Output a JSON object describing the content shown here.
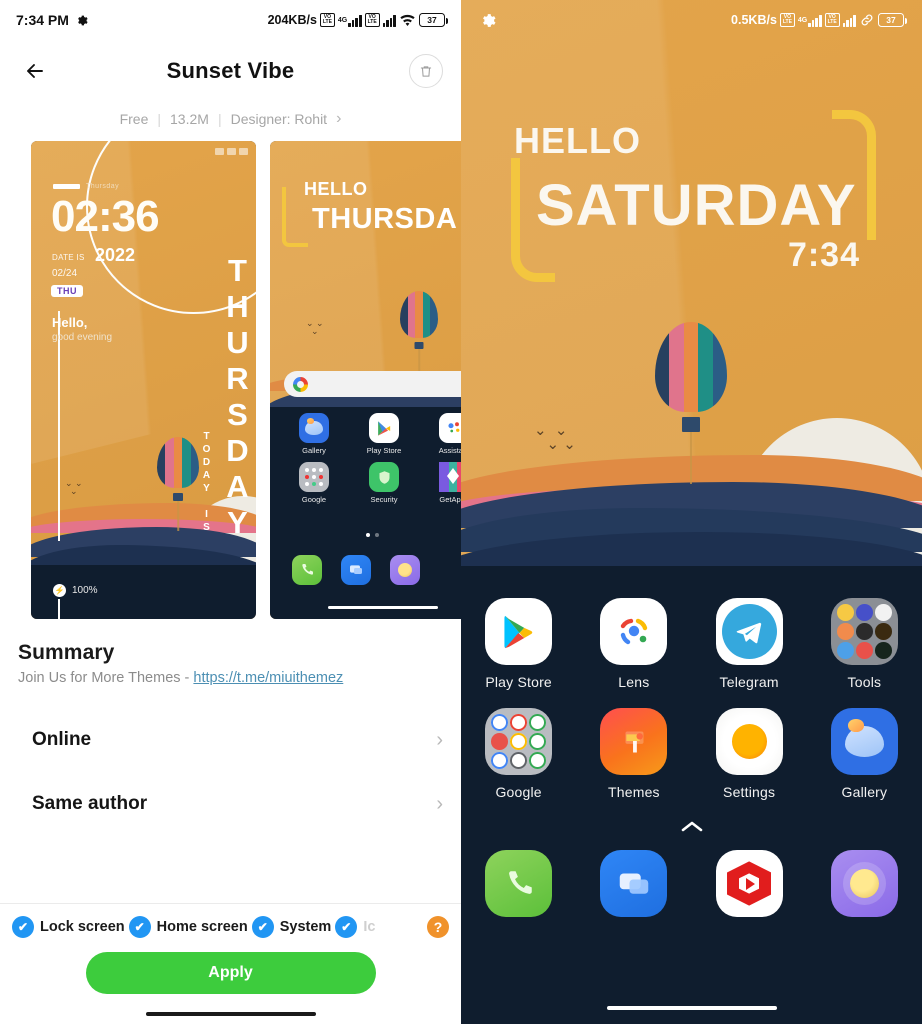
{
  "left": {
    "status_bar": {
      "time": "7:34 PM",
      "gear_icon": "gear-icon",
      "net_speed": "204KB/s",
      "volte_label_top": "VO",
      "volte_label_bottom": "LTE",
      "network_type": "4G",
      "battery_percent": "37"
    },
    "app_bar": {
      "back_icon": "arrow-left-icon",
      "title": "Sunset Vibe",
      "delete_icon": "trash-icon"
    },
    "meta": {
      "price": "Free",
      "size": "13.2M",
      "designer": "Designer: Rohit",
      "chevron": "›"
    },
    "preview_lock": {
      "preheader": "Thursday",
      "time": "02:36",
      "date_is_label": "DATE IS",
      "year": "2022",
      "month_day": "02/24",
      "dow_badge": "THU",
      "greeting": "Hello,",
      "greeting_sub": "good evening",
      "vertical_day": "THURSDAY",
      "vertical_sub": "TODAY IS",
      "battery": "100%"
    },
    "preview_home": {
      "hello": "HELLO",
      "day": "THURSDA",
      "search_icon": "google-g-icon",
      "apps": [
        {
          "label": "Gallery",
          "icon": "gallery-icon"
        },
        {
          "label": "Play Store",
          "icon": "play-store-icon"
        },
        {
          "label": "Assistant",
          "icon": "assistant-icon"
        },
        {
          "label": "Google",
          "icon": "google-folder-icon"
        },
        {
          "label": "Security",
          "icon": "security-icon"
        },
        {
          "label": "GetApps",
          "icon": "getapps-icon"
        }
      ],
      "dock": [
        {
          "label": "Phone",
          "icon": "phone-icon"
        },
        {
          "label": "Messages",
          "icon": "messages-icon"
        },
        {
          "label": "Media",
          "icon": "player-icon"
        }
      ]
    },
    "summary": {
      "heading": "Summary",
      "text_prefix": "Join Us for More Themes - ",
      "link": "https://t.me/miuithemez"
    },
    "list": [
      {
        "label": "Online",
        "chevron": "›"
      },
      {
        "label": "Same author",
        "chevron": "›"
      }
    ],
    "apply_area": {
      "checkboxes": [
        {
          "label": "Lock screen",
          "checked": true,
          "faded": false
        },
        {
          "label": "Home screen",
          "checked": true,
          "faded": false
        },
        {
          "label": "System",
          "checked": true,
          "faded": false
        },
        {
          "label": "Ic",
          "checked": true,
          "faded": true
        }
      ],
      "check_glyph": "✔",
      "help_label": "?",
      "apply_label": "Apply"
    }
  },
  "right": {
    "status_bar": {
      "gear_icon": "gear-icon",
      "net_speed": "0.5KB/s",
      "volte_label_top": "VO",
      "volte_label_bottom": "LTE",
      "network_type": "4G",
      "link_icon": "link-icon",
      "battery_percent": "37"
    },
    "wallpaper_widget": {
      "hello": "HELLO",
      "day": "SATURDAY",
      "clock": "7:34"
    },
    "apps_row1": [
      {
        "label": "Play Store",
        "icon": "play-store-icon"
      },
      {
        "label": "Lens",
        "icon": "lens-icon"
      },
      {
        "label": "Telegram",
        "icon": "telegram-icon"
      },
      {
        "label": "Tools",
        "icon": "tools-folder-icon"
      }
    ],
    "apps_row2": [
      {
        "label": "Google",
        "icon": "google-folder-icon"
      },
      {
        "label": "Themes",
        "icon": "themes-icon"
      },
      {
        "label": "Settings",
        "icon": "settings-icon"
      },
      {
        "label": "Gallery",
        "icon": "gallery-icon"
      }
    ],
    "dock_arrow_icon": "chevron-up-icon",
    "dock": [
      {
        "label": "Phone",
        "icon": "phone-icon"
      },
      {
        "label": "Messages",
        "icon": "messages-icon"
      },
      {
        "label": "Media Player",
        "icon": "player-icon"
      },
      {
        "label": "Purple App",
        "icon": "purple-app-icon"
      }
    ]
  },
  "colors": {
    "accent_green": "#3dcc3d",
    "checkbox_blue": "#2196f3",
    "help_orange": "#f0922b",
    "link_blue": "#4c8fb3",
    "wall_orange": "#dd9f46",
    "bracket_yellow": "#f3c63f"
  }
}
